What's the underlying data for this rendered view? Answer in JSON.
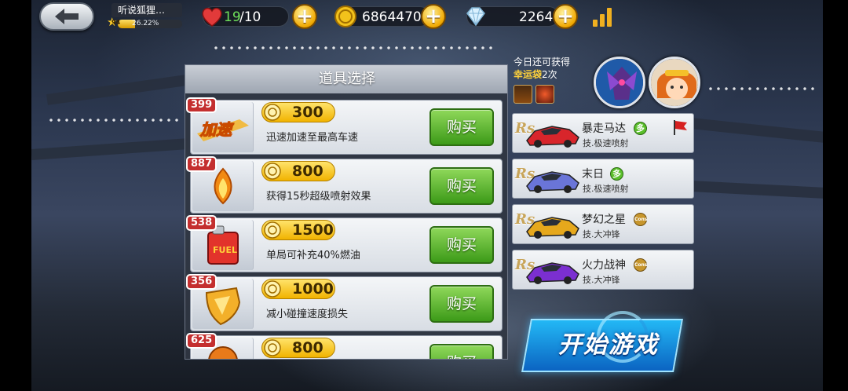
{
  "top_bar": {
    "player_name": "听说狐狸…",
    "level": "94",
    "xp_percent": "26.22%",
    "xp_fraction": 0.2622,
    "hearts_current": "19",
    "hearts_max": "/10",
    "coins": "6864470",
    "diamonds": "2264",
    "plus_label": "+"
  },
  "shop": {
    "title": "道具选择",
    "buy_label": "购买",
    "items": [
      {
        "count": "399",
        "price": "300",
        "desc": "迅速加速至最高车速",
        "icon": "speed-boost-icon",
        "thumb_text": "加速"
      },
      {
        "count": "887",
        "price": "800",
        "desc": "获得15秒超级喷射效果",
        "icon": "jet-flame-icon"
      },
      {
        "count": "538",
        "price": "1500",
        "desc": "单局可补充40%燃油",
        "icon": "fuel-can-icon",
        "thumb_text": "FUEL"
      },
      {
        "count": "356",
        "price": "1000",
        "desc": "减小碰撞速度损失",
        "icon": "shield-icon"
      },
      {
        "count": "625",
        "price": "800",
        "desc": "",
        "icon": "orb-icon"
      }
    ]
  },
  "lucky_bag": {
    "line1": "今日还可获得",
    "label": "幸运袋",
    "count": "2次"
  },
  "cars": [
    {
      "rank": "Rs",
      "name": "暴走马达",
      "skill": "技.极速喷射",
      "badge": "green",
      "badge_text": "多",
      "color": "#d8252b",
      "flag": true
    },
    {
      "rank": "Rs",
      "name": "末日",
      "skill": "技.极速喷射",
      "badge": "green",
      "badge_text": "多",
      "color": "#6a75d8",
      "flag": false
    },
    {
      "rank": "Rs",
      "name": "梦幻之星",
      "skill": "技.大冲锋",
      "badge": "gold",
      "badge_text": "Cons",
      "color": "#e6a81c",
      "flag": false
    },
    {
      "rank": "Rs",
      "name": "火力战神",
      "skill": "技.大冲锋",
      "badge": "gold",
      "badge_text": "Cons",
      "color": "#7b2fd0",
      "flag": false
    }
  ],
  "start_button": "开始游戏",
  "colors": {
    "buy_green": "#3c9a18",
    "price_gold": "#f1b300",
    "count_red": "#c42f2f",
    "start_blue": "#0b64c2"
  }
}
